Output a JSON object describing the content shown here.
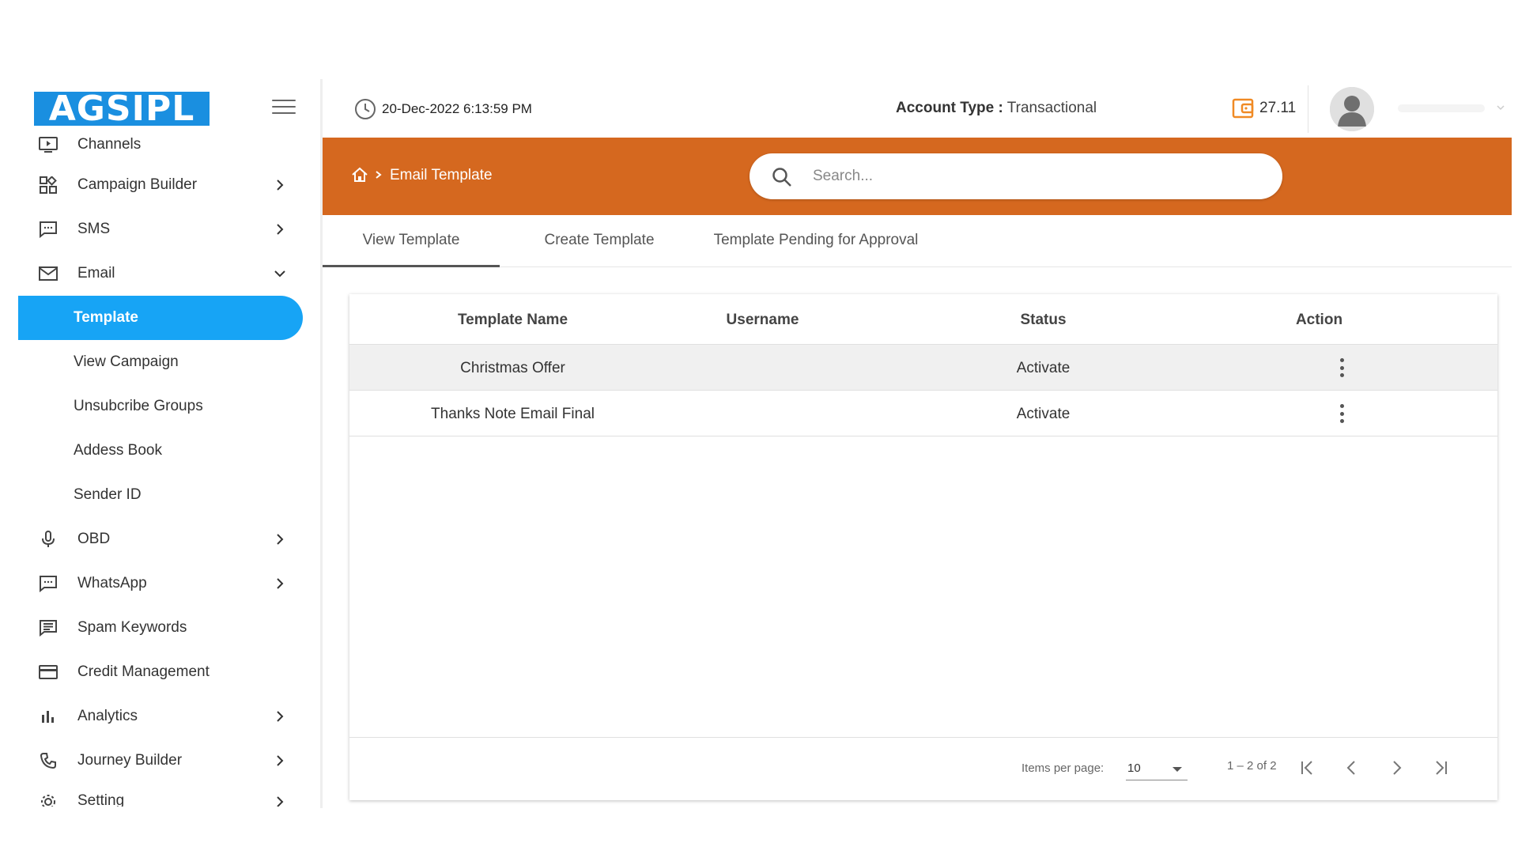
{
  "brand": {
    "logo_text": "AGSIPL"
  },
  "sidebar": {
    "items": [
      {
        "id": "channels",
        "label": "Channels",
        "icon": "monitor-play-icon",
        "chevron": false
      },
      {
        "id": "campaign-builder",
        "label": "Campaign Builder",
        "icon": "grid-icon",
        "chevron": "right"
      },
      {
        "id": "sms",
        "label": "SMS",
        "icon": "message-icon",
        "chevron": "right"
      },
      {
        "id": "email",
        "label": "Email",
        "icon": "mail-icon",
        "chevron": "down"
      }
    ],
    "email_sub": [
      {
        "id": "template",
        "label": "Template",
        "active": true
      },
      {
        "id": "view-campaign",
        "label": "View Campaign"
      },
      {
        "id": "unsubscribe-groups",
        "label": "Unsubcribe Groups"
      },
      {
        "id": "address-book",
        "label": "Addess Book"
      },
      {
        "id": "sender-id",
        "label": "Sender ID"
      }
    ],
    "items_after": [
      {
        "id": "obd",
        "label": "OBD",
        "icon": "microphone-icon",
        "chevron": "right"
      },
      {
        "id": "whatsapp",
        "label": "WhatsApp",
        "icon": "chat-dots-icon",
        "chevron": "right"
      },
      {
        "id": "spam-keywords",
        "label": "Spam Keywords",
        "icon": "list-message-icon",
        "chevron": false
      },
      {
        "id": "credit-management",
        "label": "Credit Management",
        "icon": "credit-card-icon",
        "chevron": false
      },
      {
        "id": "analytics",
        "label": "Analytics",
        "icon": "bar-chart-icon",
        "chevron": "right"
      },
      {
        "id": "journey-builder",
        "label": "Journey Builder",
        "icon": "phone-icon",
        "chevron": "right"
      },
      {
        "id": "setting",
        "label": "Setting",
        "icon": "gear-icon",
        "chevron": "right"
      }
    ]
  },
  "topbar": {
    "datetime": "20-Dec-2022 6:13:59 PM",
    "account_label": "Account Type :",
    "account_value": " Transactional",
    "balance": "27.11"
  },
  "banner": {
    "breadcrumb": "Email Template",
    "search_placeholder": "Search..."
  },
  "tabs": [
    {
      "label": "View Template",
      "active": true
    },
    {
      "label": "Create Template"
    },
    {
      "label": "Template Pending for Approval"
    }
  ],
  "table": {
    "columns": [
      "Template Name",
      "Username",
      "Status",
      "Action"
    ],
    "rows": [
      {
        "name": "Christmas Offer",
        "username": "",
        "status": "Activate"
      },
      {
        "name": "Thanks Note Email Final",
        "username": "",
        "status": "Activate"
      }
    ]
  },
  "pager": {
    "items_per_page_label": "Items per page:",
    "items_per_page": "10",
    "range": "1 – 2 of 2"
  },
  "colors": {
    "accent": "#17a4f5",
    "banner": "#d5681f",
    "logo_bg": "#1a8fe0",
    "wallet": "#f08a24"
  }
}
